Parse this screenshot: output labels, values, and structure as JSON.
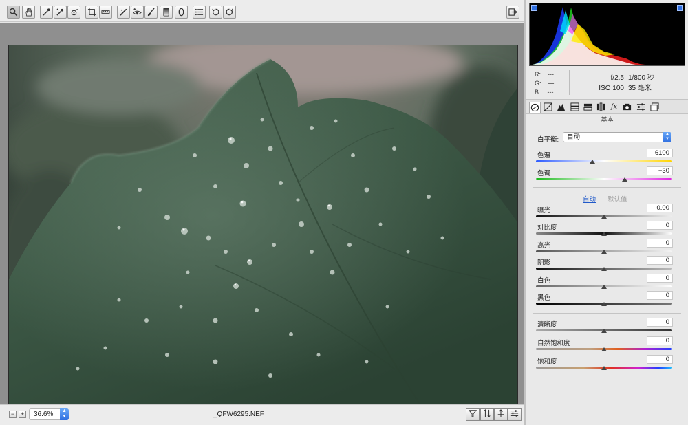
{
  "toolbar": {
    "tools": [
      "zoom-tool",
      "hand-tool",
      "white-balance-tool",
      "color-sampler-tool",
      "targeted-adjustment-tool",
      "crop-tool",
      "straighten-tool",
      "spot-removal-tool",
      "red-eye-tool",
      "adjustment-brush-tool",
      "graduated-filter-tool",
      "radial-filter-tool",
      "preferences",
      "rotate-ccw",
      "rotate-cw"
    ],
    "toggle_fullscreen": "fullscreen"
  },
  "status": {
    "zoom_minus": "−",
    "zoom_plus": "+",
    "zoom_value": "36.6%",
    "filename": "_QFW6295.NEF"
  },
  "histogram": {
    "r_label": "R:",
    "r_value": "---",
    "g_label": "G:",
    "g_value": "---",
    "b_label": "B:",
    "b_value": "---"
  },
  "camera": {
    "aperture": "f/2.5",
    "shutter": "1/800 秒",
    "iso": "ISO 100",
    "focal": "35 毫米"
  },
  "tabs": [
    "basic",
    "tone-curve",
    "detail",
    "hsl",
    "split-toning",
    "lens",
    "fx",
    "camera-calibration",
    "presets",
    "snapshots"
  ],
  "basic": {
    "section_title": "基本",
    "wb_label": "白平衡:",
    "wb_value": "自动",
    "temp_label": "色温",
    "temp_value": "6100",
    "tint_label": "色调",
    "tint_value": "+30",
    "auto_link": "自动",
    "default_link": "默认值",
    "exposure_label": "曝光",
    "exposure_value": "0.00",
    "contrast_label": "对比度",
    "contrast_value": "0",
    "highlights_label": "高光",
    "highlights_value": "0",
    "shadows_label": "阴影",
    "shadows_value": "0",
    "whites_label": "白色",
    "whites_value": "0",
    "blacks_label": "黑色",
    "blacks_value": "0",
    "clarity_label": "清晰度",
    "clarity_value": "0",
    "vibrance_label": "自然饱和度",
    "vibrance_value": "0",
    "saturation_label": "饱和度",
    "saturation_value": "0"
  },
  "colors": {
    "accent": "#2f6fe0",
    "leaf": "#3b5a45"
  }
}
